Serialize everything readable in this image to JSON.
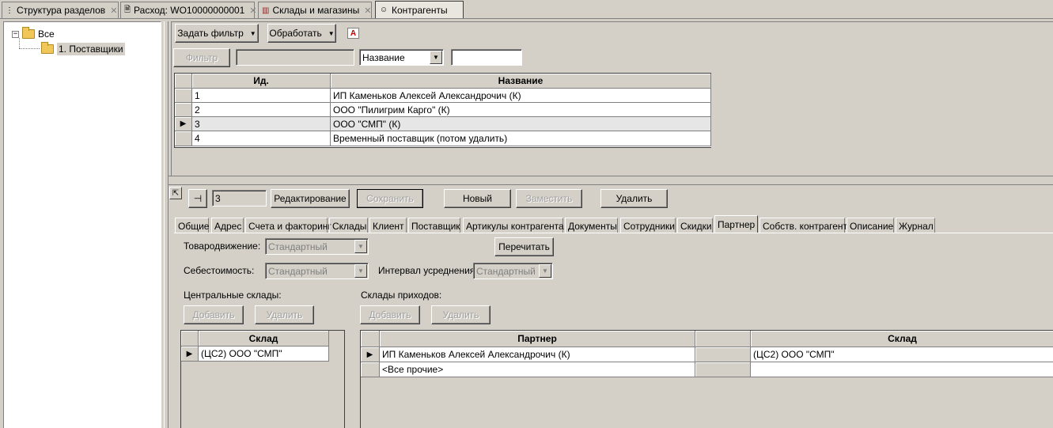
{
  "doc_tabs": [
    {
      "label": "Структура разделов"
    },
    {
      "label": "Расход: WO10000000001"
    },
    {
      "label": "Склады и магазины"
    },
    {
      "label": "Контрагенты"
    }
  ],
  "tree": {
    "root": "Все",
    "child": "1. Поставщики"
  },
  "toolbar": {
    "filter_menu": "Задать фильтр",
    "process_menu": "Обработать",
    "filter_button": "Фильтр",
    "filter_value": "",
    "field_select": "Название",
    "search_value": ""
  },
  "main_grid": {
    "columns": [
      "Ид.",
      "Название"
    ],
    "rows": [
      {
        "id": "1",
        "name": "ИП Каменьков Алексей Александрочич (К)"
      },
      {
        "id": "2",
        "name": "ООО \"Пилигрим Карго\" (К)"
      },
      {
        "id": "3",
        "name": "ООО \"СМП\" (К)"
      },
      {
        "id": "4",
        "name": "Временный поставщик (потом удалить)"
      }
    ]
  },
  "record_bar": {
    "record_id": "3",
    "edit": "Редактирование",
    "save": "Сохранить",
    "new": "Новый",
    "replace": "Заместить",
    "delete": "Удалить"
  },
  "page_tabs": [
    "Общие",
    "Адрес",
    "Счета и факторинг",
    "Склады",
    "Клиент",
    "Поставщик",
    "Артикулы контрагента",
    "Документы",
    "Сотрудники",
    "Скидки",
    "Партнер",
    "Собств. контрагент",
    "Описание",
    "Журнал"
  ],
  "partner": {
    "movement_label": "Товародвижение:",
    "movement_value": "Стандартный",
    "reread": "Перечитать",
    "cost_label": "Себестоимость:",
    "cost_value": "Стандартный",
    "interval_label": "Интервал усреднения:",
    "interval_value": "Стандартный",
    "central_label": "Центральные склады:",
    "income_label": "Склады приходов:",
    "add": "Добавить",
    "remove": "Удалить",
    "central_grid": {
      "column": "Склад",
      "rows": [
        "(ЦС2) ООО \"СМП\""
      ]
    },
    "income_grid": {
      "columns": [
        "Партнер",
        "",
        "Склад"
      ],
      "rows": [
        {
          "partner": "ИП Каменьков Алексей Александрочич (К)",
          "warehouse": "(ЦС2) ООО \"СМП\""
        },
        {
          "partner": "<Все прочие>",
          "warehouse": ""
        }
      ]
    }
  }
}
